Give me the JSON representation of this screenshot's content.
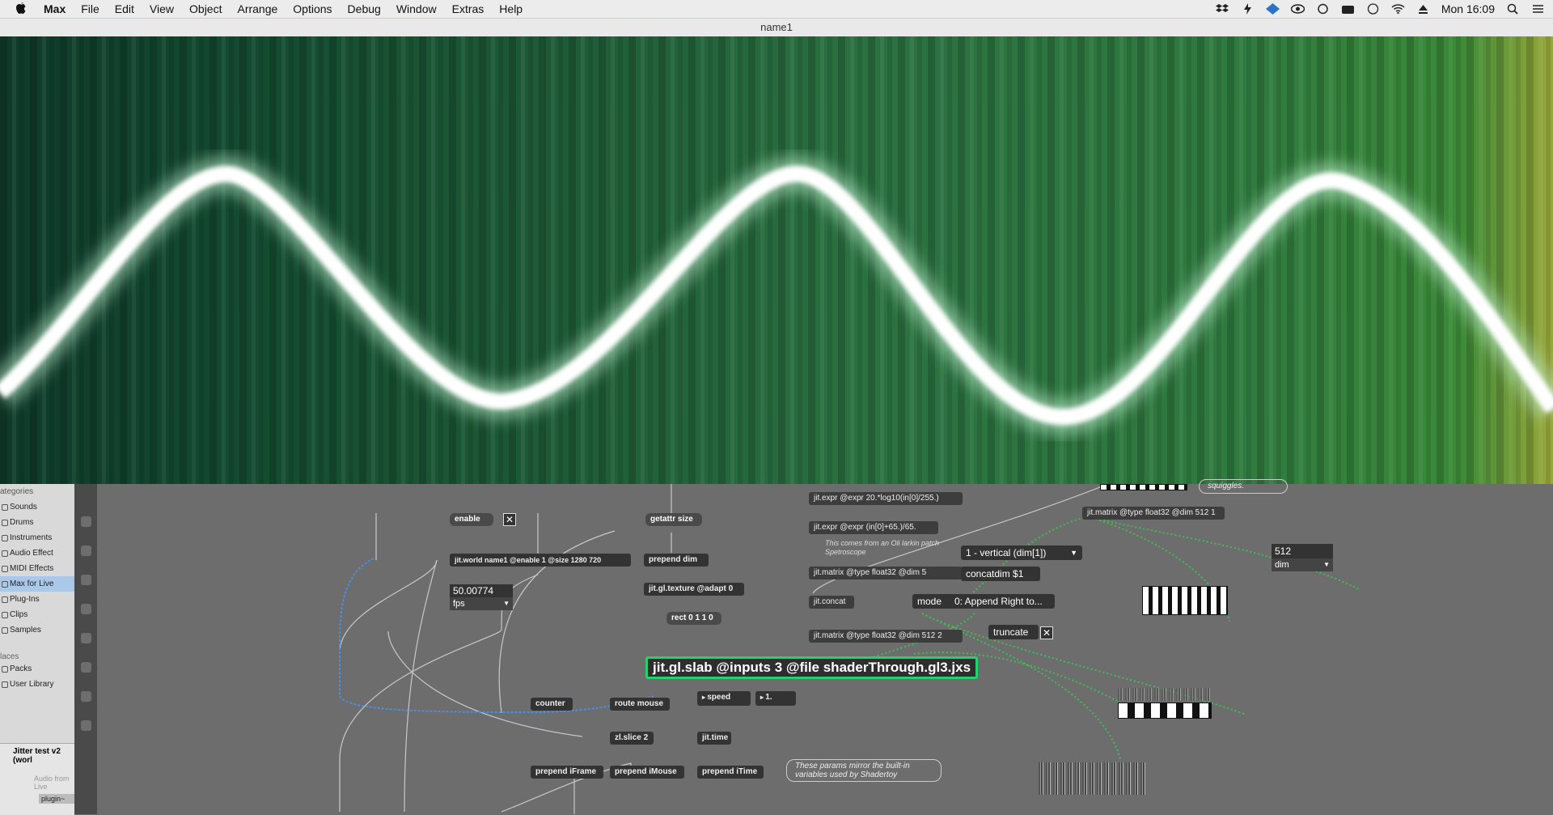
{
  "menubar": {
    "app": "Max",
    "items": [
      "File",
      "Edit",
      "View",
      "Object",
      "Arrange",
      "Options",
      "Debug",
      "Window",
      "Extras",
      "Help"
    ],
    "clock": "Mon 16:09"
  },
  "window": {
    "title": "name1"
  },
  "browser": {
    "header": "ategories",
    "categories": [
      "Sounds",
      "Drums",
      "Instruments",
      "Audio Effect",
      "MIDI Effects",
      "Max for Live",
      "Plug-Ins",
      "Clips",
      "Samples"
    ],
    "selected": "Max for Live",
    "places_header": "laces",
    "places": [
      "Packs",
      "User Library"
    ],
    "device_title": "Jitter test v2 (worl",
    "device_sub": "Audio from Live",
    "device_plugin": "plugin~"
  },
  "patch": {
    "enable_msg": "enable",
    "getattr": "getattr size",
    "world": "jit.world name1 @enable 1 @size 1280 720",
    "prepend_dim": "prepend dim",
    "fps_value": "50.00774",
    "fps_menu": "fps",
    "texture": "jit.gl.texture @adapt 0",
    "rect": "rect 0 1 1 0",
    "slab": "jit.gl.slab @inputs 3 @file shaderThrough.gl3.jxs",
    "counter": "counter",
    "route_mouse": "route mouse",
    "speed": "speed",
    "speed_val": "1.",
    "zl_slice": "zl.slice 2",
    "jit_time": "jit.time",
    "prepend_iframe": "prepend iFrame",
    "prepend_imouse": "prepend iMouse",
    "prepend_itime": "prepend iTime",
    "comment_params": "These params mirror the built-in variables used by Shadertoy",
    "expr1": "jit.expr @expr 20.*log10(in[0]/255.)",
    "expr2": "jit.expr @expr (in[0]+65.)/65.",
    "comment_oli": "This comes from an Oli larkin patch Spetroscope",
    "matrix1": "jit.matrix @type float32 @dim 5",
    "matrix2": "jit.matrix @type float32 @dim 512 2",
    "matrix_top": "jit.matrix @type float32 @dim 512 1",
    "vertical_menu": "1 - vertical (dim[1])",
    "concatdim": "concatdim $1",
    "concat": "jit.concat",
    "mode": "mode",
    "mode_menu": "0: Append Right to...",
    "truncate": "truncate",
    "dim_value": "512",
    "dim_menu": "dim",
    "squiggles": "squiggles."
  },
  "colors": {
    "accent": "#1fd46d",
    "patchbg": "#6d6d6d",
    "wave": "#ffffff"
  }
}
